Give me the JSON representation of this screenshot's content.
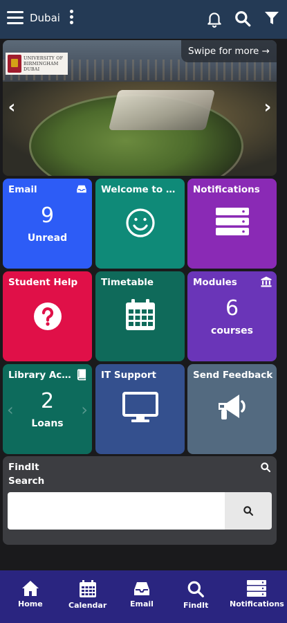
{
  "header": {
    "title": "Dubai",
    "menu_icon": "menu-icon",
    "kebab_icon": "more-vertical-icon",
    "bell_icon": "bell-icon",
    "search_icon": "search-icon",
    "filter_icon": "filter-icon",
    "bg_color": "#243a55"
  },
  "carousel": {
    "swipe_label": "Swipe for more →",
    "logo_lines": [
      "UNIVERSITY OF",
      "BIRMINGHAM",
      "DUBAI"
    ],
    "prev_icon": "chevron-left-icon",
    "next_icon": "chevron-right-icon"
  },
  "tiles": {
    "email": {
      "title": "Email",
      "count": "9",
      "sub": "Unread",
      "icon": "inbox-icon",
      "color": "#2d5cf6"
    },
    "welcome": {
      "title": "Welcome to M...",
      "icon": "smile-icon",
      "color": "#0f8a78"
    },
    "notifications": {
      "title": "Notifications",
      "icon": "server-icon",
      "color": "#8a2ab5"
    },
    "student_help": {
      "title": "Student Help",
      "icon": "question-circle-icon",
      "color": "#e01048"
    },
    "timetable": {
      "title": "Timetable",
      "icon": "calendar-icon",
      "color": "#0f6a5a"
    },
    "modules": {
      "title": "Modules",
      "count": "6",
      "sub": "courses",
      "icon": "university-icon",
      "color": "#6a35b8"
    },
    "library": {
      "title": "Library Acco...",
      "count": "2",
      "sub": "Loans",
      "icon": "book-icon",
      "color": "#0d6b5c"
    },
    "it_support": {
      "title": "IT Support",
      "icon": "monitor-icon",
      "color": "#34508e"
    },
    "feedback": {
      "title": "Send Feedback",
      "icon": "megaphone-icon",
      "color": "#536a80"
    }
  },
  "findit": {
    "title": "FindIt",
    "subtitle": "Search",
    "placeholder": "",
    "value": ""
  },
  "bottom_nav": {
    "items": [
      {
        "label": "Home",
        "icon": "home-icon"
      },
      {
        "label": "Calendar",
        "icon": "calendar-icon"
      },
      {
        "label": "Email",
        "icon": "inbox-icon"
      },
      {
        "label": "FindIt",
        "icon": "search-icon"
      },
      {
        "label": "Notifications",
        "icon": "server-icon"
      }
    ],
    "bg_color": "#2a2580"
  }
}
